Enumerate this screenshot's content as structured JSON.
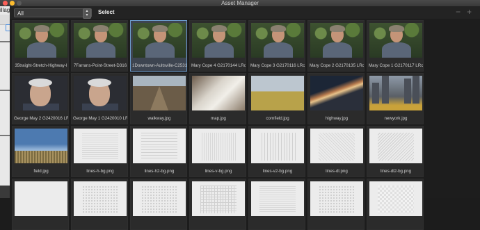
{
  "window": {
    "title": "Asset Manager"
  },
  "background_app": {
    "partial_text": "illag"
  },
  "toolbar": {
    "filter_value": "All",
    "select_label": "Select"
  },
  "rows": [
    [
      {
        "caption": "35traight-Stretch-Highway-I",
        "thumb": "portrait"
      },
      {
        "caption": "7Farrans-Point-Street-D316",
        "thumb": "portrait"
      },
      {
        "caption": "1Downtown-Aultsville-C2531",
        "thumb": "portrait",
        "selected": true
      },
      {
        "caption": "Mary Cope 4 G2170144 LRc1",
        "thumb": "portrait"
      },
      {
        "caption": "Mary Cope 3 G2170116 LRc1",
        "thumb": "portrait"
      },
      {
        "caption": "Mary Cope 2 G2170135 LRc1",
        "thumb": "portrait"
      },
      {
        "caption": "Mary Cope 1 G2170117 LRc1",
        "thumb": "portrait"
      }
    ],
    [
      {
        "caption": "George May 2 G2420016 LRc",
        "thumb": "oldman"
      },
      {
        "caption": "George May 1 G2420010 LRc",
        "thumb": "oldman"
      },
      {
        "caption": "walkway.jpg",
        "thumb": "walkway"
      },
      {
        "caption": "map.jpg",
        "thumb": "map"
      },
      {
        "caption": "cornfield.jpg",
        "thumb": "cornfield"
      },
      {
        "caption": "highway.jpg",
        "thumb": "highway"
      },
      {
        "caption": "newyork.jpg",
        "thumb": "newyork"
      }
    ],
    [
      {
        "caption": "field.jpg",
        "thumb": "field"
      },
      {
        "caption": "lines-h-bg.png",
        "thumb": "pat h"
      },
      {
        "caption": "lines-h2-bg.png",
        "thumb": "pat h2"
      },
      {
        "caption": "lines-v-bg.png",
        "thumb": "pat v"
      },
      {
        "caption": "lines-v2-bg.png",
        "thumb": "pat v2"
      },
      {
        "caption": "lines-dl.png",
        "thumb": "pat dl"
      },
      {
        "caption": "lines-dl2-bg.png",
        "thumb": "pat dl2"
      }
    ],
    [
      {
        "caption": "",
        "thumb": "pat"
      },
      {
        "caption": "",
        "thumb": "pat dots"
      },
      {
        "caption": "",
        "thumb": "pat dots"
      },
      {
        "caption": "",
        "thumb": "pat grid"
      },
      {
        "caption": "",
        "thumb": "pat h"
      },
      {
        "caption": "",
        "thumb": "pat dots"
      },
      {
        "caption": "",
        "thumb": "pat checker"
      }
    ]
  ]
}
